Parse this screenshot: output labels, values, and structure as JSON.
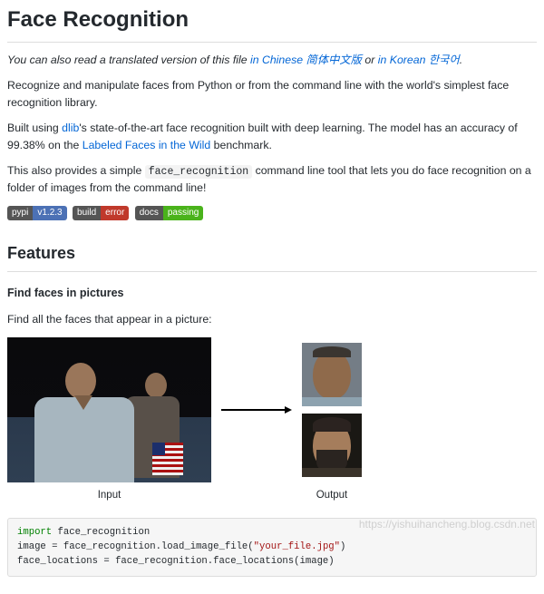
{
  "title": "Face Recognition",
  "intro": {
    "lead": "You can also read a translated version of this file ",
    "link_cn": "in Chinese 简体中文版",
    "mid": " or ",
    "link_ko": "in Korean 한국어",
    "tail": "."
  },
  "p_recognize": "Recognize and manipulate faces from Python or from the command line with the world's simplest face recognition library.",
  "p_built": {
    "a": "Built using ",
    "dlib": "dlib",
    "b": "'s state-of-the-art face recognition built with deep learning. The model has an accuracy of 99.38% on the ",
    "lfw": "Labeled Faces in the Wild",
    "c": " benchmark."
  },
  "p_cli": {
    "a": "This also provides a simple ",
    "code": "face_recognition",
    "b": " command line tool that lets you do face recognition on a folder of images from the command line!"
  },
  "badges": [
    {
      "left": "pypi",
      "right": "v1.2.3",
      "color": "blue"
    },
    {
      "left": "build",
      "right": "error",
      "color": "red"
    },
    {
      "left": "docs",
      "right": "passing",
      "color": "green"
    }
  ],
  "features_heading": "Features",
  "find_faces_heading": "Find faces in pictures",
  "find_faces_sub": "Find all the faces that appear in a picture:",
  "captions": {
    "input": "Input",
    "output": "Output"
  },
  "code": {
    "kw_import": "import",
    "l1_rest": " face_recognition",
    "l2_a": "image = face_recognition.load_image_file(",
    "l2_str": "\"your_file.jpg\"",
    "l2_b": ")",
    "l3": "face_locations = face_recognition.face_locations(image)"
  },
  "watermark": "https://yishuihancheng.blog.csdn.net"
}
